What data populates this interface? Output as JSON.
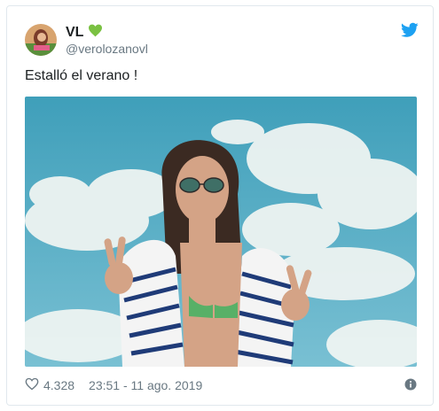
{
  "author": {
    "display_name": "VL",
    "handle": "@verolozanovl",
    "badge_icon": "green-heart-icon",
    "badge_color": "#7ac142"
  },
  "tweet": {
    "text": "Estalló el verano !"
  },
  "footer": {
    "likes": "4.328",
    "timestamp": "23:51 - 11 ago. 2019"
  },
  "colors": {
    "twitter_blue": "#1da1f2",
    "muted": "#697882",
    "border": "#e1e8ed"
  },
  "icons": [
    "twitter-logo-icon",
    "heart-outline-icon",
    "info-icon"
  ]
}
